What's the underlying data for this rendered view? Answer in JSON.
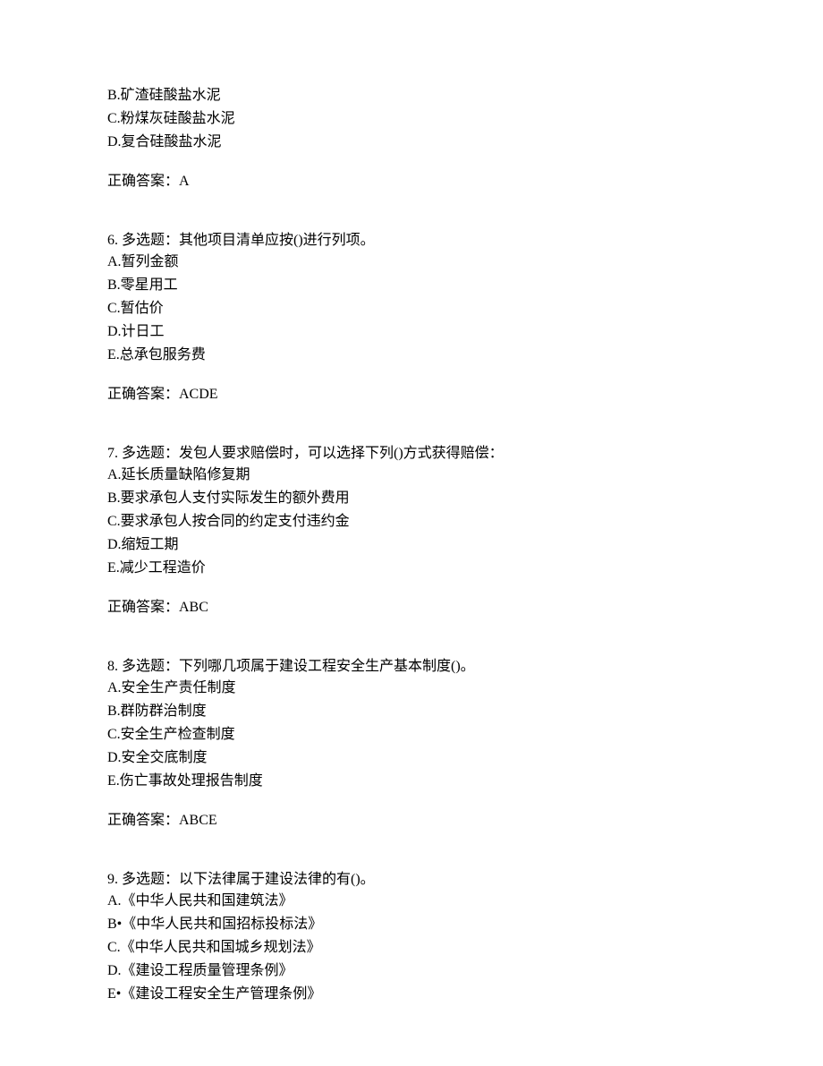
{
  "q5_tail": {
    "options": [
      "B.矿渣硅酸盐水泥",
      "C.粉煤灰硅酸盐水泥",
      "D.复合硅酸盐水泥"
    ],
    "answer": "正确答案：A"
  },
  "q6": {
    "stem": "6. 多选题：其他项目清单应按()进行列项。",
    "options": [
      "A.暂列金额",
      "B.零星用工",
      "C.暂估价",
      "D.计日工",
      "E.总承包服务费"
    ],
    "answer": "正确答案：ACDE"
  },
  "q7": {
    "stem": "7. 多选题：发包人要求赔偿时，可以选择下列()方式获得赔偿：",
    "options": [
      "A.延长质量缺陷修复期",
      "B.要求承包人支付实际发生的额外费用",
      "C.要求承包人按合同的约定支付违约金",
      "D.缩短工期",
      "E.减少工程造价"
    ],
    "answer": "正确答案：ABC"
  },
  "q8": {
    "stem": "8. 多选题：下列哪几项属于建设工程安全生产基本制度()。",
    "options": [
      "A.安全生产责任制度",
      "B.群防群治制度",
      "C.安全生产检查制度",
      "D.安全交底制度",
      "E.伤亡事故处理报告制度"
    ],
    "answer": "正确答案：ABCE"
  },
  "q9": {
    "stem": "9. 多选题：以下法律属于建设法律的有()。",
    "options": [
      "A.《中华人民共和国建筑法》",
      "B•《中华人民共和国招标投标法》",
      "C.《中华人民共和国城乡规划法》",
      "D.《建设工程质量管理条例》",
      "E•《建设工程安全生产管理条例》"
    ]
  }
}
